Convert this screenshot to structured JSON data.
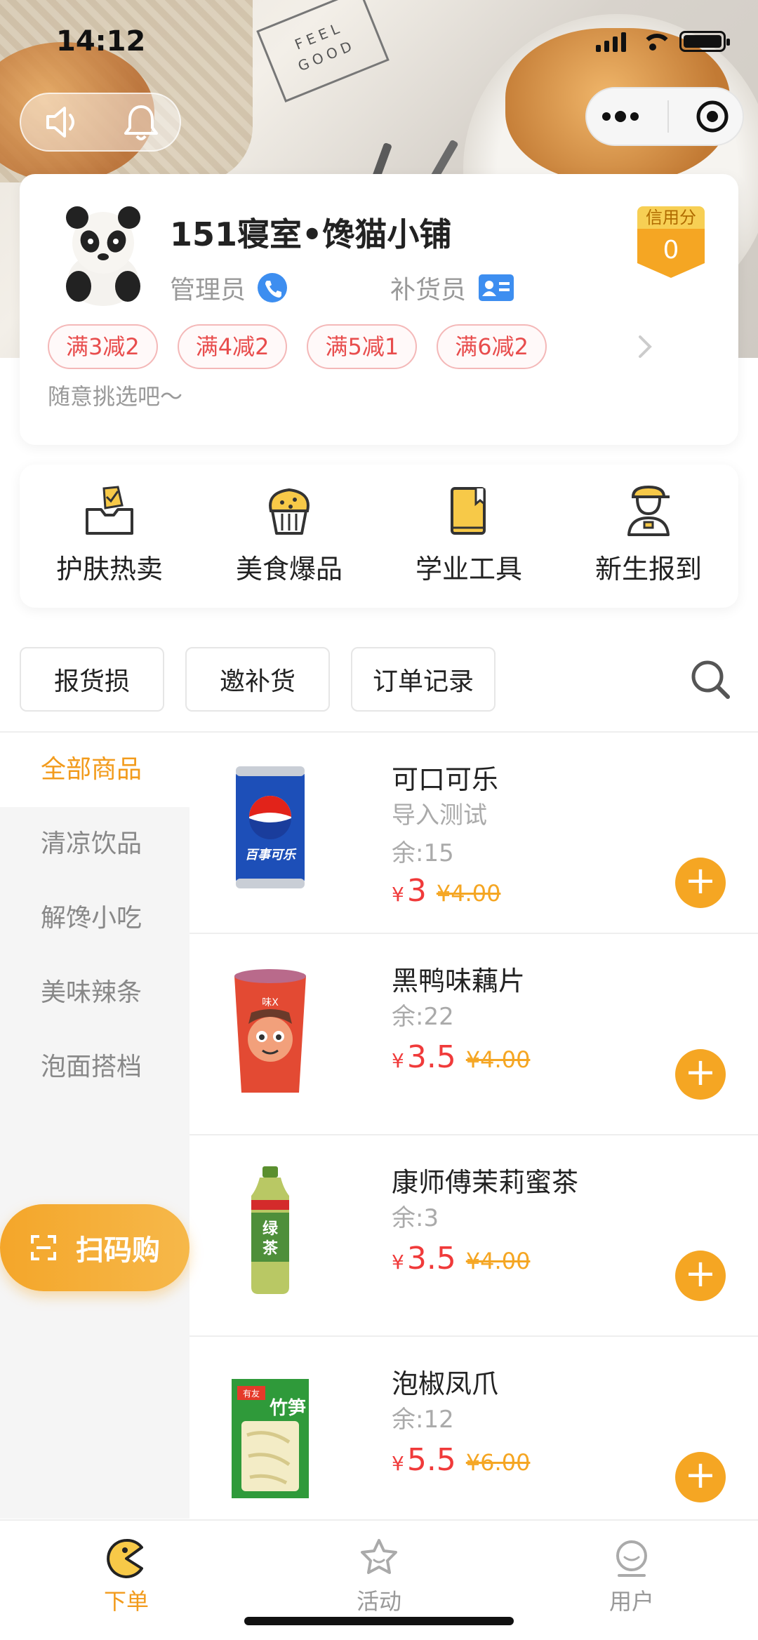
{
  "status_bar": {
    "time": "14:12"
  },
  "hero": {
    "card_text": "FEEL GOOD"
  },
  "shop": {
    "name": "151寝室•馋猫小铺",
    "role_admin": "管理员",
    "role_restock": "补货员",
    "credit_label": "信用分",
    "credit_value": "0",
    "coupons": [
      "满3减2",
      "满4减2",
      "满5减1",
      "满6减2"
    ],
    "notice": "随意挑选吧～"
  },
  "categories": [
    {
      "label": "护肤热卖",
      "icon": "checkbox-ballot-icon"
    },
    {
      "label": "美食爆品",
      "icon": "muffin-icon"
    },
    {
      "label": "学业工具",
      "icon": "book-icon"
    },
    {
      "label": "新生报到",
      "icon": "student-icon"
    }
  ],
  "actions": {
    "report_loss": "报货损",
    "invite_restock": "邀补货",
    "order_history": "订单记录"
  },
  "sidebar": {
    "items": [
      "全部商品",
      "清凉饮品",
      "解馋小吃",
      "美味辣条",
      "泡面搭档"
    ],
    "scan_label": "扫码购"
  },
  "products": [
    {
      "name": "可口可乐",
      "desc": "导入测试",
      "stock": "余:15",
      "currency": "¥",
      "price": "3",
      "old_price": "¥4.00"
    },
    {
      "name": "黑鸭味藕片",
      "desc": "",
      "stock": "余:22",
      "currency": "¥",
      "price": "3.5",
      "old_price": "¥4.00"
    },
    {
      "name": "康师傅茉莉蜜茶",
      "desc": "",
      "stock": "余:3",
      "currency": "¥",
      "price": "3.5",
      "old_price": "¥4.00"
    },
    {
      "name": "泡椒凤爪",
      "desc": "",
      "stock": "余:12",
      "currency": "¥",
      "price": "5.5",
      "old_price": "¥6.00"
    }
  ],
  "tabbar": {
    "order": "下单",
    "activity": "活动",
    "user": "用户"
  },
  "colors": {
    "accent": "#f5a623",
    "price_red": "#f03a3a",
    "active_text": "#f29b1c"
  }
}
